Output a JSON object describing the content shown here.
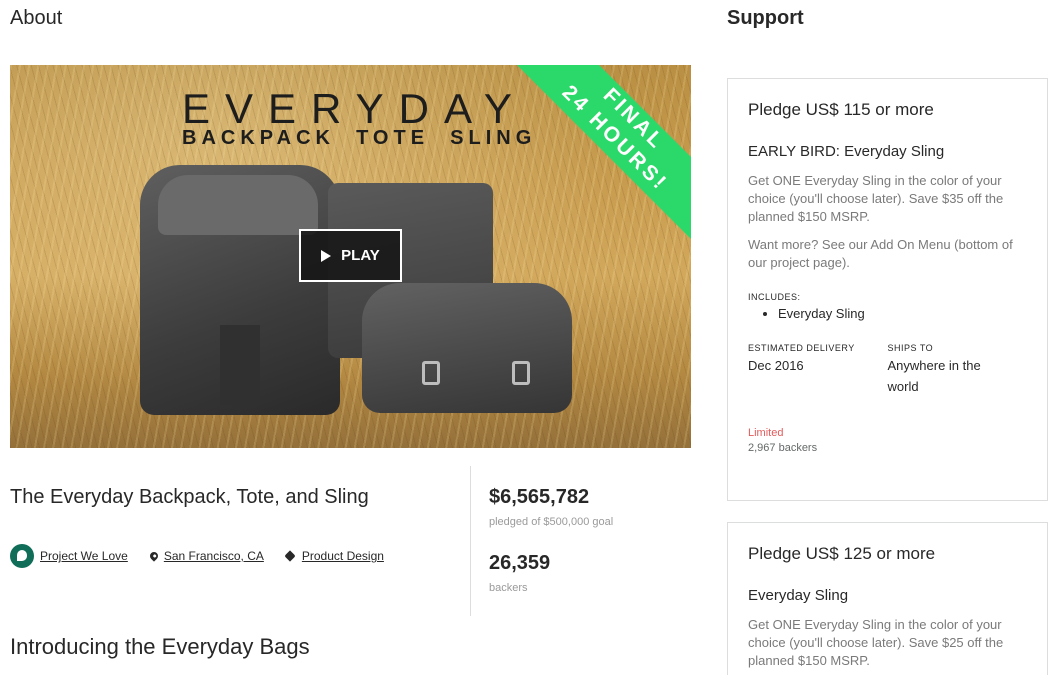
{
  "about": {
    "heading": "About"
  },
  "support": {
    "heading": "Support"
  },
  "video": {
    "title_big": "EVERYDAY",
    "title_sub": "BACKPACK TOTE SLING",
    "ribbon_line1": "FINAL",
    "ribbon_line2": "24 HOURS!",
    "play_label": "PLAY",
    "ribbon_color": "#2bd96a"
  },
  "project": {
    "title": "The Everyday Backpack, Tote, and Sling",
    "badge_label": "Project We Love",
    "location": "San Francisco, CA",
    "category": "Product Design",
    "badge_color": "#0f6d58"
  },
  "stats": {
    "pledged_value": "$6,565,782",
    "pledged_label": "pledged of $500,000 goal",
    "backers_value": "26,359",
    "backers_label": "backers"
  },
  "intro": {
    "heading": "Introducing the Everyday Bags"
  },
  "rewards": [
    {
      "title": "Pledge US$ 115 or more",
      "name": "EARLY BIRD: Everyday Sling",
      "desc": "Get ONE Everyday Sling in the color of your choice (you'll choose later). Save $35 off the planned $150 MSRP.",
      "desc2": "Want more? See our Add On Menu (bottom of our project page).",
      "includes_label": "INCLUDES:",
      "includes": [
        "Everyday Sling"
      ],
      "delivery_label": "ESTIMATED DELIVERY",
      "delivery_value": "Dec 2016",
      "ships_label": "SHIPS TO",
      "ships_value": "Anywhere in the world",
      "limited": "Limited",
      "backers": "2,967 backers"
    },
    {
      "title": "Pledge US$ 125 or more",
      "name": "Everyday Sling",
      "desc": "Get ONE Everyday Sling in the color of your choice (you'll choose later). Save $25 off the planned $150 MSRP."
    }
  ],
  "colors": {
    "limited": "#e35b5b",
    "border": "#dcdedd"
  }
}
